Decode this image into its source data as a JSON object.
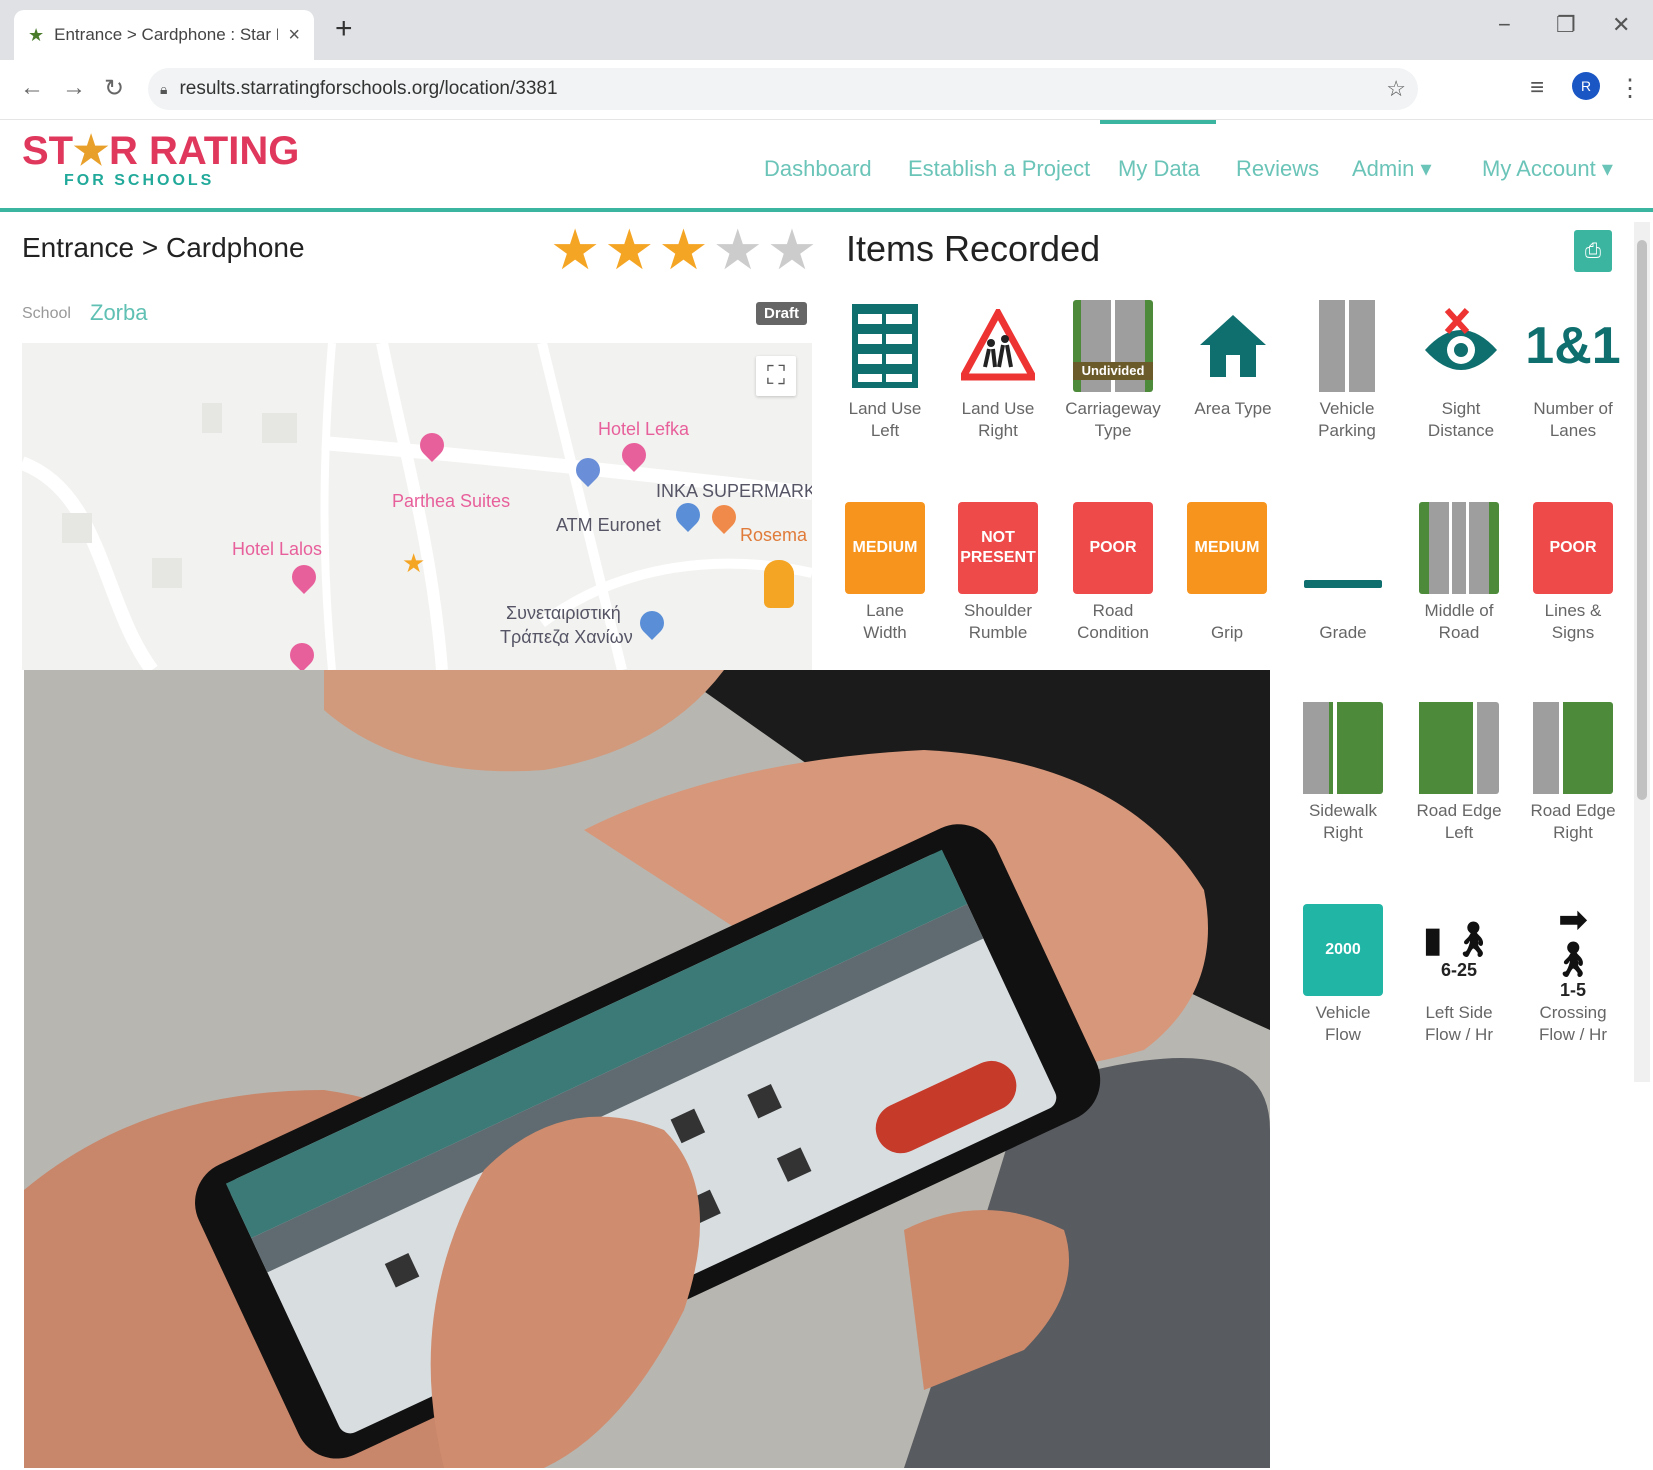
{
  "browser": {
    "tab_title": "Entrance > Cardphone : Star Rat",
    "tab_close": "×",
    "new_tab": "+",
    "url": "results.starratingforschools.org/location/3381",
    "avatar_initial": "R"
  },
  "header": {
    "logo_part1": "ST",
    "logo_star": "★",
    "logo_part2": "R RATING",
    "logo_tagline": "FOR SCHOOLS",
    "menu": {
      "dashboard": "Dashboard",
      "establish": "Establish a Project",
      "mydata": "My Data",
      "reviews": "Reviews",
      "admin": "Admin ▾",
      "account": "My Account ▾"
    },
    "active_menu": "My Data",
    "accent_color": "#3bb59f",
    "brand_color": "#e0385d"
  },
  "location": {
    "breadcrumb": "Entrance > Cardphone",
    "rating": 3,
    "rating_max": 5,
    "school_label": "School",
    "school_value": "Zorba",
    "status": "Draft"
  },
  "map": {
    "labels": {
      "hotel_lefka": "Hotel Lefka",
      "parthea": "Parthea Suites",
      "inka": "INKA SUPERMARK",
      "atm": "ATM Euronet",
      "rosemary": "Rosema",
      "hotel_lalos": "Hotel Lalos",
      "bank1": "Συνεταιριστική",
      "bank2": "Τράπεζα Χανίων"
    }
  },
  "items": {
    "title": "Items Recorded",
    "row1": [
      {
        "label1": "Land Use",
        "label2": "Left",
        "icon": "building-icon"
      },
      {
        "label1": "Land Use",
        "label2": "Right",
        "icon": "school-crossing-icon"
      },
      {
        "label1": "Carriageway",
        "label2": "Type",
        "icon": "road-icon",
        "badge": "Undivided"
      },
      {
        "label1": "Area Type",
        "label2": "",
        "icon": "house-icon"
      },
      {
        "label1": "Vehicle",
        "label2": "Parking",
        "icon": "road-icon"
      },
      {
        "label1": "Sight",
        "label2": "Distance",
        "icon": "eye-icon"
      },
      {
        "label1": "Number of",
        "label2": "Lanes",
        "icon": "lanes-icon",
        "value": "1&1"
      }
    ],
    "row2": [
      {
        "label1": "Lane",
        "label2": "Width",
        "badge": "MEDIUM"
      },
      {
        "label1": "Shoulder",
        "label2": "Rumble",
        "badge": "NOT PRESENT"
      },
      {
        "label1": "Road",
        "label2": "Condition",
        "badge": "POOR"
      },
      {
        "label1": "Grip",
        "label2": "",
        "badge": "MEDIUM"
      },
      {
        "label1": "Grade",
        "label2": ""
      },
      {
        "label1": "Middle of",
        "label2": "Road"
      },
      {
        "label1": "Lines &",
        "label2": "Signs",
        "badge": "POOR"
      }
    ],
    "row3": [
      {
        "label1": "Sidewalk",
        "label2": "Right"
      },
      {
        "label1": "Road Edge",
        "label2": "Left"
      },
      {
        "label1": "Road Edge",
        "label2": "Right"
      }
    ],
    "row4": [
      {
        "label1": "Vehicle",
        "label2": "Flow",
        "badge": "2000"
      },
      {
        "label1": "Left Side",
        "label2": "Flow / Hr",
        "value": "6-25"
      },
      {
        "label1": "Crossing",
        "label2": "Flow / Hr",
        "value": "1-5"
      }
    ]
  },
  "photo": {
    "description_icon": "phone-in-hands-photo"
  }
}
